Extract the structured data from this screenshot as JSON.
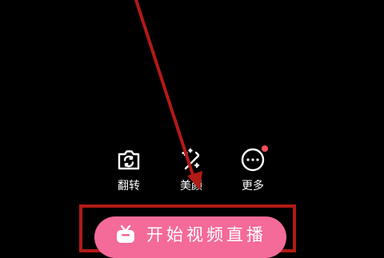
{
  "tools": [
    {
      "icon": "camera-flip-icon",
      "label": "翻转"
    },
    {
      "icon": "magic-wand-icon",
      "label": "美颜"
    },
    {
      "icon": "more-icon",
      "label": "更多"
    }
  ],
  "live_button": {
    "icon": "tv-icon",
    "label": "开始视频直播"
  },
  "colors": {
    "background": "#000000",
    "button_pink": "#f46a98",
    "annotation_red": "#b21a16",
    "notification_dot": "#ff4d5e"
  }
}
